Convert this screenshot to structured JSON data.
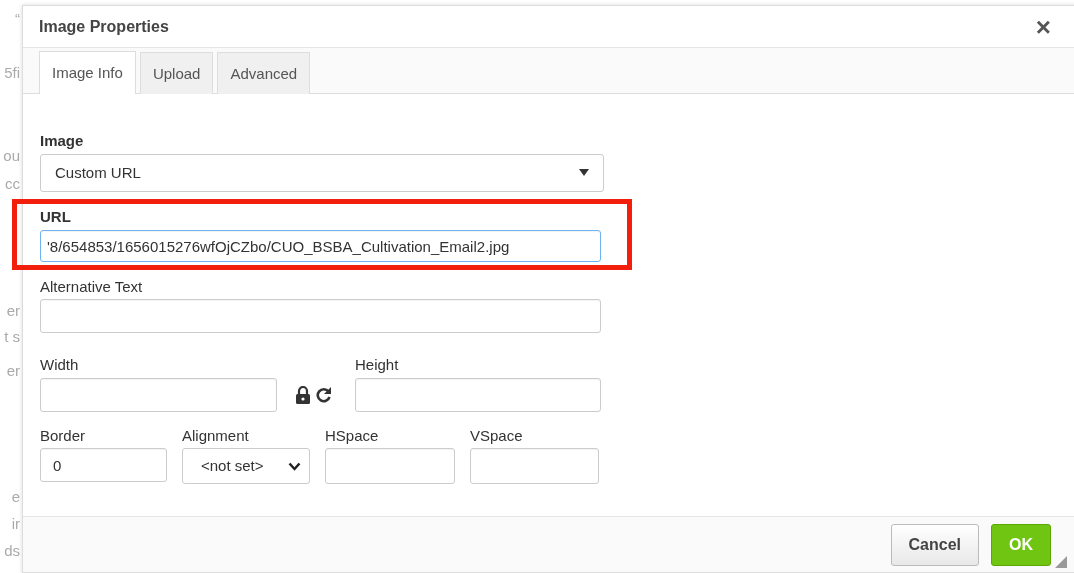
{
  "background_fragments": [
    "“",
    "5fi",
    "ou",
    "cc",
    "er",
    "t s",
    "er",
    "e",
    "ir",
    "ds"
  ],
  "dialog": {
    "title": "Image Properties",
    "close": "×"
  },
  "tabs": [
    {
      "label": "Image Info",
      "selected": true
    },
    {
      "label": "Upload",
      "selected": false
    },
    {
      "label": "Advanced",
      "selected": false
    }
  ],
  "image_source": {
    "label": "Image",
    "value": "Custom URL"
  },
  "url": {
    "label": "URL",
    "value": "'8/654853/1656015276wfOjCZbo/CUO_BSBA_Cultivation_Email2.jpg",
    "highlighted": true
  },
  "alternative_text": {
    "label": "Alternative Text"
  },
  "width": {
    "label": "Width"
  },
  "height": {
    "label": "Height"
  },
  "border": {
    "label": "Border",
    "value": "0"
  },
  "alignment": {
    "label": "Alignment",
    "value": "<not set>"
  },
  "hspace": {
    "label": "HSpace"
  },
  "vspace": {
    "label": "VSpace"
  },
  "buttons": [
    {
      "label": "Cancel",
      "kind": "secondary"
    },
    {
      "label": "OK",
      "kind": "primary"
    }
  ]
}
